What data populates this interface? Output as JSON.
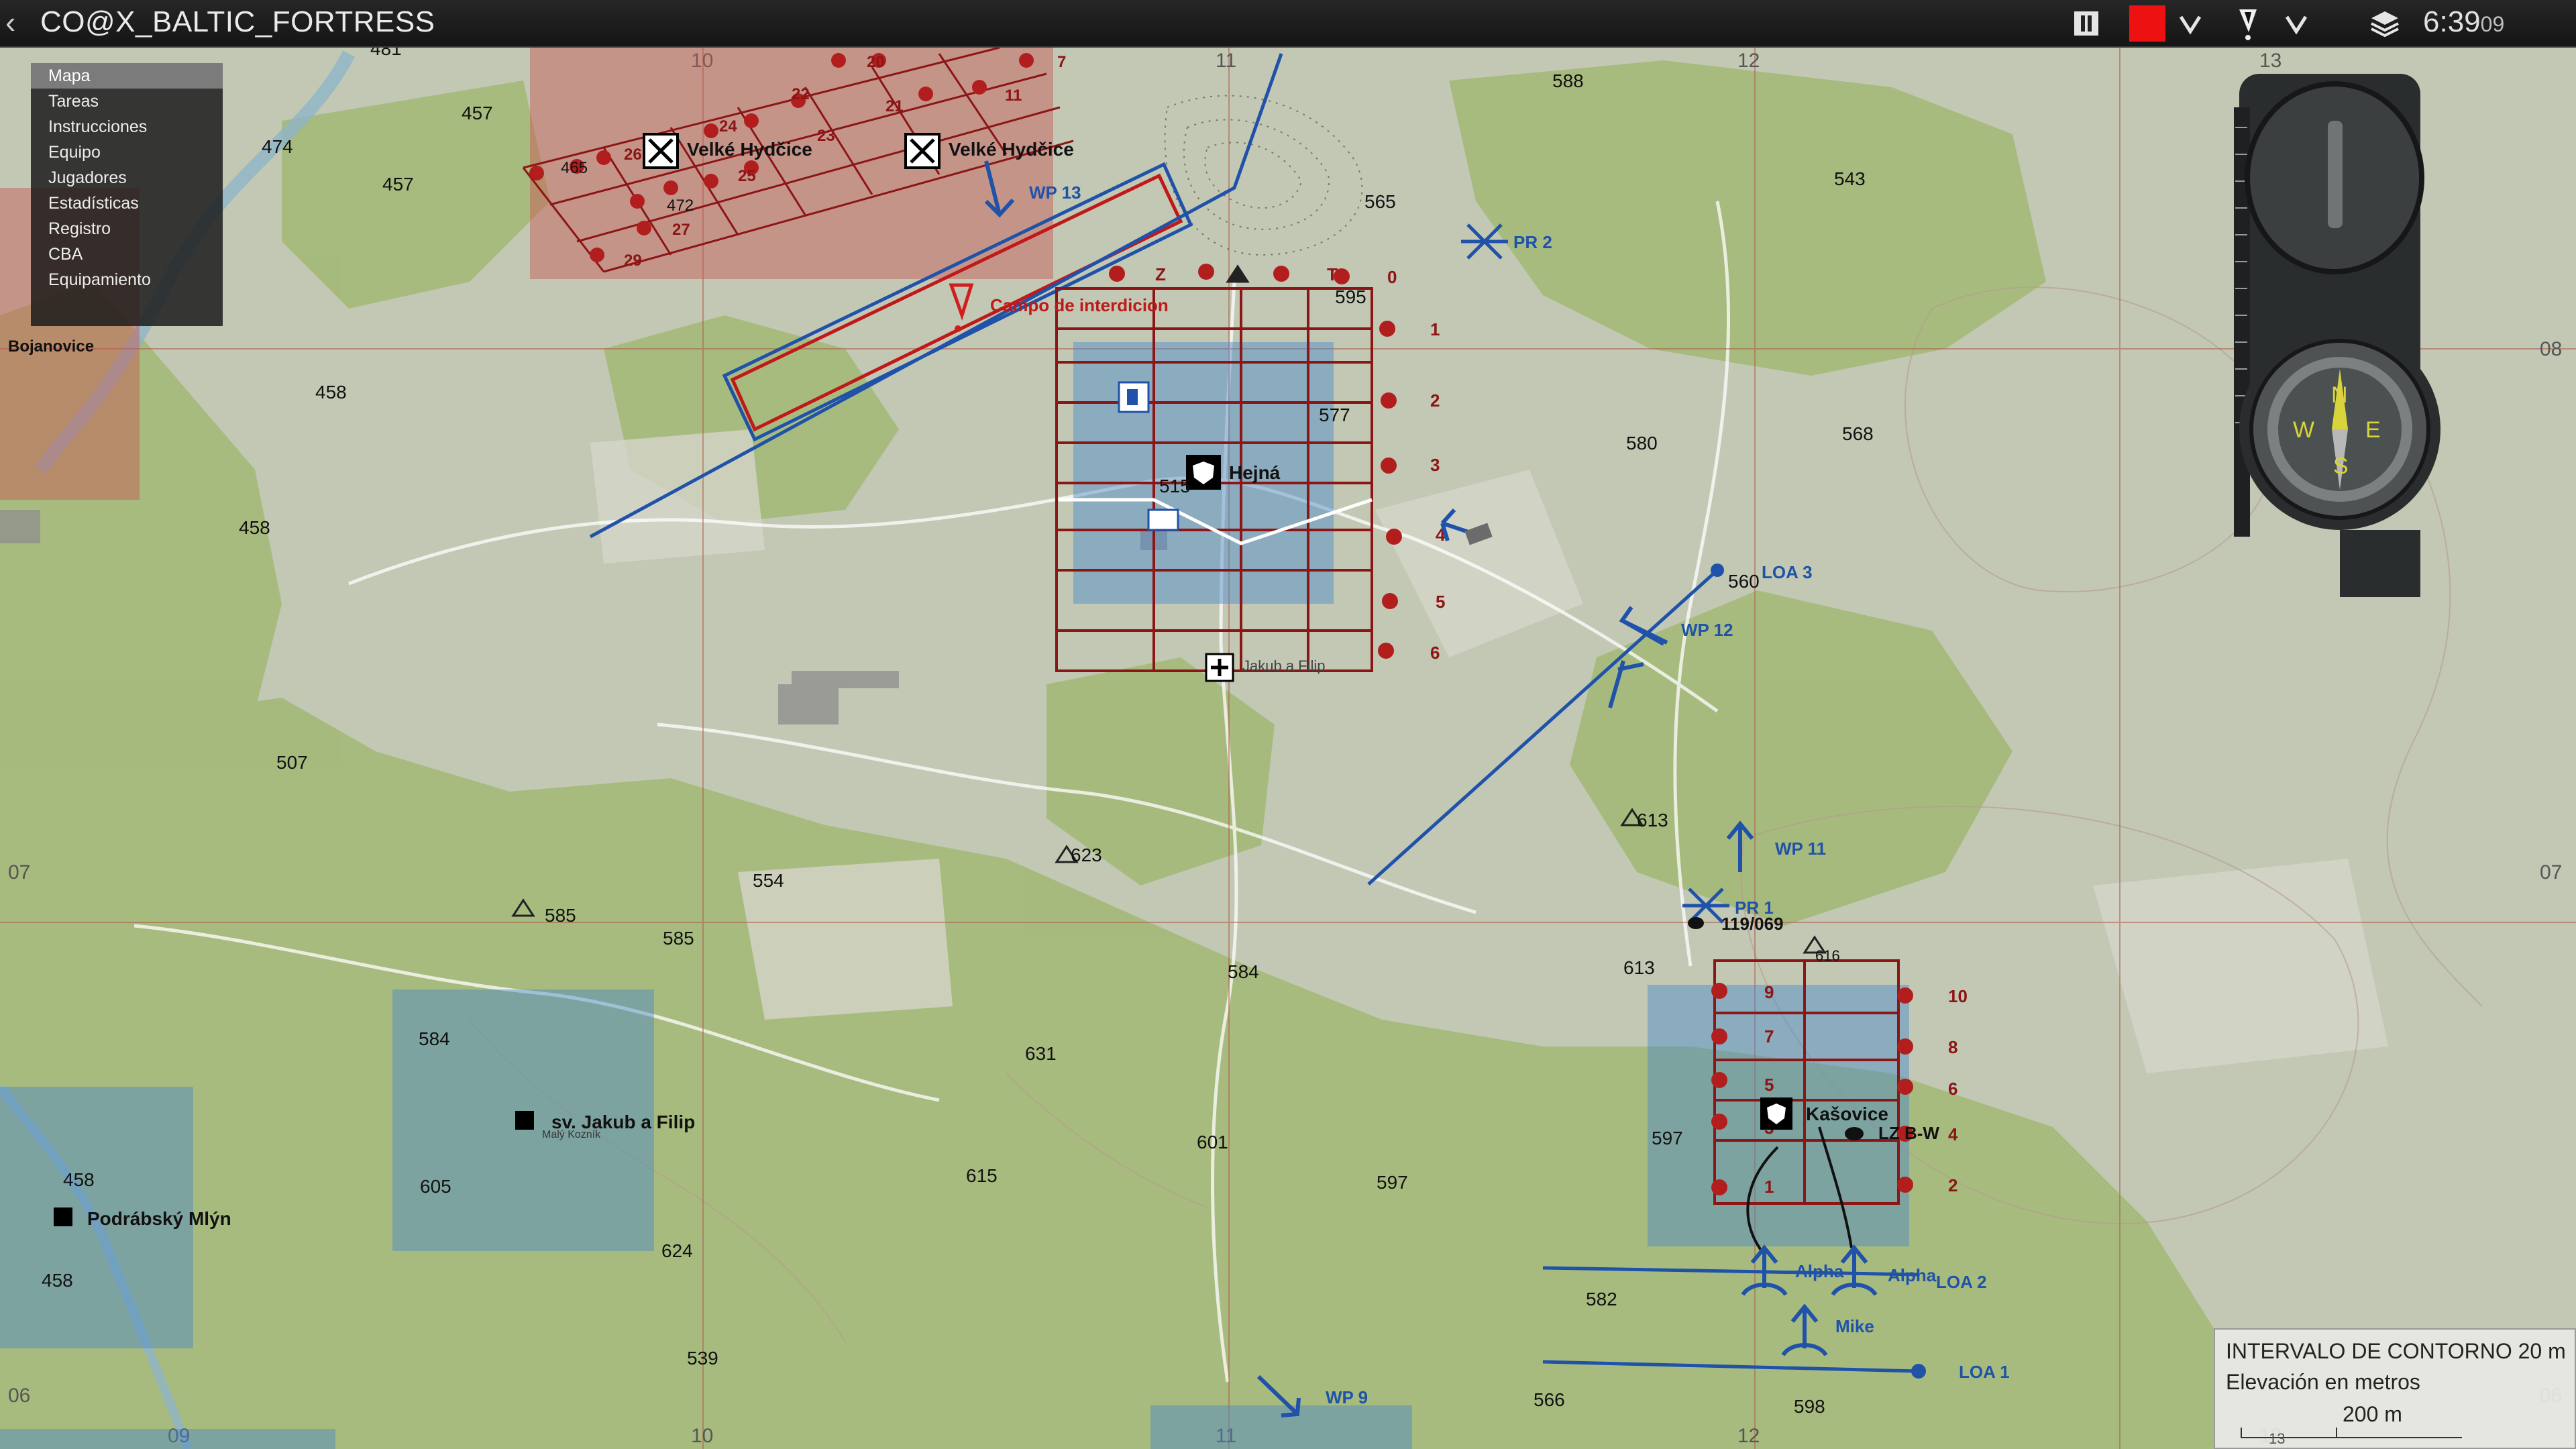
{
  "window": {
    "title": "CO@X_BALTIC_FORTRESS",
    "clock_main": "6:39",
    "clock_seconds": "09",
    "toolbar_icons": [
      "pause-icon",
      "red-marker-color-icon",
      "chevron-down-icon",
      "marker-type-icon",
      "chevron-down-icon",
      "layers-icon"
    ],
    "marker_color": "#ee1111"
  },
  "menu": {
    "items": [
      {
        "label": "Mapa",
        "selected": true
      },
      {
        "label": "Tareas",
        "selected": false
      },
      {
        "label": "Instrucciones",
        "selected": false
      },
      {
        "label": "Equipo",
        "selected": false
      },
      {
        "label": "Jugadores",
        "selected": false
      },
      {
        "label": "Estadísticas",
        "selected": false
      },
      {
        "label": "Registro",
        "selected": false
      },
      {
        "label": "CBA",
        "selected": false
      },
      {
        "label": "Equipamiento",
        "selected": false
      }
    ]
  },
  "legend": {
    "line1": "INTERVALO DE CONTORNO 20 m",
    "line2": "Elevación en metros",
    "scale": "200 m",
    "scale_tick": "13"
  },
  "colors": {
    "terrain": "#b9c1a8",
    "forest": "#a5b97a",
    "blue_marker": "#1f52a8",
    "red_marker": "#8c1515",
    "red_dot": "#b21e1e",
    "blue_zone": "#4a88c9",
    "red_zone": "#c95555"
  },
  "map": {
    "grid_labels": {
      "top": [
        "10",
        "11",
        "12",
        "13"
      ],
      "bottom": [
        "09",
        "10",
        "11",
        "12",
        "13"
      ],
      "left": [
        "07",
        "06"
      ],
      "right": [
        "08",
        "07",
        "06"
      ]
    },
    "place_names": [
      "Velké Hydčice",
      "Velké Hydčice",
      "Bojanovice",
      "Hejná",
      "sv. Jakub a Filip",
      "Podrábský Mlýn",
      "Kašovice",
      "Jakub a Filip",
      "Malý Kozník"
    ],
    "elevations": [
      "481",
      "474",
      "457",
      "457",
      "458",
      "458",
      "507",
      "554",
      "585",
      "585",
      "584",
      "605",
      "624",
      "458",
      "458",
      "539",
      "631",
      "615",
      "601",
      "597",
      "584",
      "623",
      "565",
      "588",
      "543",
      "577",
      "580",
      "568",
      "560",
      "613",
      "613",
      "616",
      "597",
      "582",
      "566",
      "598",
      "595",
      "515",
      "465",
      "472"
    ],
    "waypoints": [
      "WP 13",
      "WP 12",
      "WP 11",
      "WP 9",
      "PR 2",
      "PR 1",
      "LOA 3",
      "LOA 2",
      "LOA 1",
      "Alpha",
      "Alpha",
      "Mike",
      "LZ B-W",
      "119/069"
    ],
    "annotations": [
      "Campo de interdicion",
      "Z",
      "T"
    ],
    "grid1_row_labels": [
      "0",
      "1",
      "2",
      "3",
      "4",
      "5",
      "6"
    ],
    "grid2_right_labels": [
      "10",
      "8",
      "6",
      "4",
      "2"
    ],
    "grid2_inner_labels": [
      "9",
      "7",
      "5",
      "3",
      "1"
    ],
    "village_dot_labels": [
      "20",
      "22",
      "23",
      "21",
      "24",
      "25",
      "26",
      "27",
      "29",
      "11",
      "7"
    ]
  }
}
